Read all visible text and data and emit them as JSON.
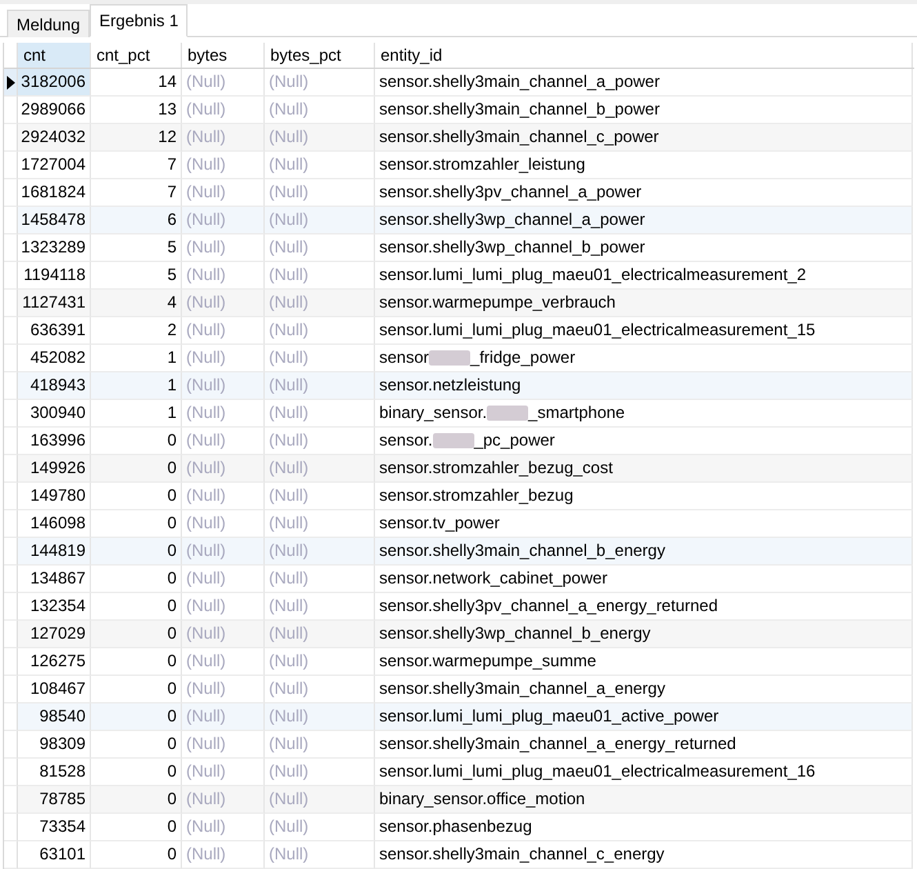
{
  "tabs": [
    {
      "label": "Meldung",
      "selected": false
    },
    {
      "label": "Ergebnis 1",
      "selected": true
    }
  ],
  "table": {
    "columns": [
      {
        "label": "cnt",
        "kind": "number",
        "selected": true
      },
      {
        "label": "cnt_pct",
        "kind": "number",
        "selected": false
      },
      {
        "label": "bytes",
        "kind": "text",
        "selected": false
      },
      {
        "label": "bytes_pct",
        "kind": "text",
        "selected": false
      },
      {
        "label": "entity_id",
        "kind": "text",
        "selected": false
      }
    ],
    "rows": [
      {
        "selected": true,
        "cells": [
          {
            "text": "3182006",
            "null": false
          },
          {
            "text": "14",
            "null": false
          },
          {
            "text": "(Null)",
            "null": true
          },
          {
            "text": "(Null)",
            "null": true
          },
          {
            "text": "sensor.shelly3main_channel_a_power",
            "null": false,
            "redacted": false
          }
        ]
      },
      {
        "selected": false,
        "cells": [
          {
            "text": "2989066",
            "null": false
          },
          {
            "text": "13",
            "null": false
          },
          {
            "text": "(Null)",
            "null": true
          },
          {
            "text": "(Null)",
            "null": true
          },
          {
            "text": "sensor.shelly3main_channel_b_power",
            "null": false,
            "redacted": false
          }
        ]
      },
      {
        "selected": false,
        "cells": [
          {
            "text": "2924032",
            "null": false
          },
          {
            "text": "12",
            "null": false
          },
          {
            "text": "(Null)",
            "null": true
          },
          {
            "text": "(Null)",
            "null": true
          },
          {
            "text": "sensor.shelly3main_channel_c_power",
            "null": false,
            "redacted": false
          }
        ]
      },
      {
        "selected": false,
        "cells": [
          {
            "text": "1727004",
            "null": false
          },
          {
            "text": "7",
            "null": false
          },
          {
            "text": "(Null)",
            "null": true
          },
          {
            "text": "(Null)",
            "null": true
          },
          {
            "text": "sensor.stromzahler_leistung",
            "null": false,
            "redacted": false
          }
        ]
      },
      {
        "selected": false,
        "cells": [
          {
            "text": "1681824",
            "null": false
          },
          {
            "text": "7",
            "null": false
          },
          {
            "text": "(Null)",
            "null": true
          },
          {
            "text": "(Null)",
            "null": true
          },
          {
            "text": "sensor.shelly3pv_channel_a_power",
            "null": false,
            "redacted": false
          }
        ]
      },
      {
        "selected": false,
        "cells": [
          {
            "text": "1458478",
            "null": false
          },
          {
            "text": "6",
            "null": false
          },
          {
            "text": "(Null)",
            "null": true
          },
          {
            "text": "(Null)",
            "null": true
          },
          {
            "text": "sensor.shelly3wp_channel_a_power",
            "null": false,
            "redacted": false
          }
        ]
      },
      {
        "selected": false,
        "cells": [
          {
            "text": "1323289",
            "null": false
          },
          {
            "text": "5",
            "null": false
          },
          {
            "text": "(Null)",
            "null": true
          },
          {
            "text": "(Null)",
            "null": true
          },
          {
            "text": "sensor.shelly3wp_channel_b_power",
            "null": false,
            "redacted": false
          }
        ]
      },
      {
        "selected": false,
        "cells": [
          {
            "text": "1194118",
            "null": false
          },
          {
            "text": "5",
            "null": false
          },
          {
            "text": "(Null)",
            "null": true
          },
          {
            "text": "(Null)",
            "null": true
          },
          {
            "text": "sensor.lumi_lumi_plug_maeu01_electricalmeasurement_2",
            "null": false,
            "redacted": false
          }
        ]
      },
      {
        "selected": false,
        "cells": [
          {
            "text": "1127431",
            "null": false
          },
          {
            "text": "4",
            "null": false
          },
          {
            "text": "(Null)",
            "null": true
          },
          {
            "text": "(Null)",
            "null": true
          },
          {
            "text": "sensor.warmepumpe_verbrauch",
            "null": false,
            "redacted": false
          }
        ]
      },
      {
        "selected": false,
        "cells": [
          {
            "text": "636391",
            "null": false
          },
          {
            "text": "2",
            "null": false
          },
          {
            "text": "(Null)",
            "null": true
          },
          {
            "text": "(Null)",
            "null": true
          },
          {
            "text": "sensor.lumi_lumi_plug_maeu01_electricalmeasurement_15",
            "null": false,
            "redacted": false
          }
        ]
      },
      {
        "selected": false,
        "cells": [
          {
            "text": "452082",
            "null": false
          },
          {
            "text": "1",
            "null": false
          },
          {
            "text": "(Null)",
            "null": true
          },
          {
            "text": "(Null)",
            "null": true
          },
          {
            "text": "sensor",
            "null": false,
            "redacted": true,
            "text_after": "_fridge_power"
          }
        ]
      },
      {
        "selected": false,
        "cells": [
          {
            "text": "418943",
            "null": false
          },
          {
            "text": "1",
            "null": false
          },
          {
            "text": "(Null)",
            "null": true
          },
          {
            "text": "(Null)",
            "null": true
          },
          {
            "text": "sensor.netzleistung",
            "null": false,
            "redacted": false
          }
        ]
      },
      {
        "selected": false,
        "cells": [
          {
            "text": "300940",
            "null": false
          },
          {
            "text": "1",
            "null": false
          },
          {
            "text": "(Null)",
            "null": true
          },
          {
            "text": "(Null)",
            "null": true
          },
          {
            "text": "binary_sensor.",
            "null": false,
            "redacted": true,
            "text_after": "_smartphone"
          }
        ]
      },
      {
        "selected": false,
        "cells": [
          {
            "text": "163996",
            "null": false
          },
          {
            "text": "0",
            "null": false
          },
          {
            "text": "(Null)",
            "null": true
          },
          {
            "text": "(Null)",
            "null": true
          },
          {
            "text": "sensor.",
            "null": false,
            "redacted": true,
            "text_after": "_pc_power"
          }
        ]
      },
      {
        "selected": false,
        "cells": [
          {
            "text": "149926",
            "null": false
          },
          {
            "text": "0",
            "null": false
          },
          {
            "text": "(Null)",
            "null": true
          },
          {
            "text": "(Null)",
            "null": true
          },
          {
            "text": "sensor.stromzahler_bezug_cost",
            "null": false,
            "redacted": false
          }
        ]
      },
      {
        "selected": false,
        "cells": [
          {
            "text": "149780",
            "null": false
          },
          {
            "text": "0",
            "null": false
          },
          {
            "text": "(Null)",
            "null": true
          },
          {
            "text": "(Null)",
            "null": true
          },
          {
            "text": "sensor.stromzahler_bezug",
            "null": false,
            "redacted": false
          }
        ]
      },
      {
        "selected": false,
        "cells": [
          {
            "text": "146098",
            "null": false
          },
          {
            "text": "0",
            "null": false
          },
          {
            "text": "(Null)",
            "null": true
          },
          {
            "text": "(Null)",
            "null": true
          },
          {
            "text": "sensor.tv_power",
            "null": false,
            "redacted": false
          }
        ]
      },
      {
        "selected": false,
        "cells": [
          {
            "text": "144819",
            "null": false
          },
          {
            "text": "0",
            "null": false
          },
          {
            "text": "(Null)",
            "null": true
          },
          {
            "text": "(Null)",
            "null": true
          },
          {
            "text": "sensor.shelly3main_channel_b_energy",
            "null": false,
            "redacted": false
          }
        ]
      },
      {
        "selected": false,
        "cells": [
          {
            "text": "134867",
            "null": false
          },
          {
            "text": "0",
            "null": false
          },
          {
            "text": "(Null)",
            "null": true
          },
          {
            "text": "(Null)",
            "null": true
          },
          {
            "text": "sensor.network_cabinet_power",
            "null": false,
            "redacted": false
          }
        ]
      },
      {
        "selected": false,
        "cells": [
          {
            "text": "132354",
            "null": false
          },
          {
            "text": "0",
            "null": false
          },
          {
            "text": "(Null)",
            "null": true
          },
          {
            "text": "(Null)",
            "null": true
          },
          {
            "text": "sensor.shelly3pv_channel_a_energy_returned",
            "null": false,
            "redacted": false
          }
        ]
      },
      {
        "selected": false,
        "cells": [
          {
            "text": "127029",
            "null": false
          },
          {
            "text": "0",
            "null": false
          },
          {
            "text": "(Null)",
            "null": true
          },
          {
            "text": "(Null)",
            "null": true
          },
          {
            "text": "sensor.shelly3wp_channel_b_energy",
            "null": false,
            "redacted": false
          }
        ]
      },
      {
        "selected": false,
        "cells": [
          {
            "text": "126275",
            "null": false
          },
          {
            "text": "0",
            "null": false
          },
          {
            "text": "(Null)",
            "null": true
          },
          {
            "text": "(Null)",
            "null": true
          },
          {
            "text": "sensor.warmepumpe_summe",
            "null": false,
            "redacted": false
          }
        ]
      },
      {
        "selected": false,
        "cells": [
          {
            "text": "108467",
            "null": false
          },
          {
            "text": "0",
            "null": false
          },
          {
            "text": "(Null)",
            "null": true
          },
          {
            "text": "(Null)",
            "null": true
          },
          {
            "text": "sensor.shelly3main_channel_a_energy",
            "null": false,
            "redacted": false
          }
        ]
      },
      {
        "selected": false,
        "cells": [
          {
            "text": "98540",
            "null": false
          },
          {
            "text": "0",
            "null": false
          },
          {
            "text": "(Null)",
            "null": true
          },
          {
            "text": "(Null)",
            "null": true
          },
          {
            "text": "sensor.lumi_lumi_plug_maeu01_active_power",
            "null": false,
            "redacted": false
          }
        ]
      },
      {
        "selected": false,
        "cells": [
          {
            "text": "98309",
            "null": false
          },
          {
            "text": "0",
            "null": false
          },
          {
            "text": "(Null)",
            "null": true
          },
          {
            "text": "(Null)",
            "null": true
          },
          {
            "text": "sensor.shelly3main_channel_a_energy_returned",
            "null": false,
            "redacted": false
          }
        ]
      },
      {
        "selected": false,
        "cells": [
          {
            "text": "81528",
            "null": false
          },
          {
            "text": "0",
            "null": false
          },
          {
            "text": "(Null)",
            "null": true
          },
          {
            "text": "(Null)",
            "null": true
          },
          {
            "text": "sensor.lumi_lumi_plug_maeu01_electricalmeasurement_16",
            "null": false,
            "redacted": false
          }
        ]
      },
      {
        "selected": false,
        "cells": [
          {
            "text": "78785",
            "null": false
          },
          {
            "text": "0",
            "null": false
          },
          {
            "text": "(Null)",
            "null": true
          },
          {
            "text": "(Null)",
            "null": true
          },
          {
            "text": "binary_sensor.office_motion",
            "null": false,
            "redacted": false
          }
        ]
      },
      {
        "selected": false,
        "cells": [
          {
            "text": "73354",
            "null": false
          },
          {
            "text": "0",
            "null": false
          },
          {
            "text": "(Null)",
            "null": true
          },
          {
            "text": "(Null)",
            "null": true
          },
          {
            "text": "sensor.phasenbezug",
            "null": false,
            "redacted": false
          }
        ]
      },
      {
        "selected": false,
        "cells": [
          {
            "text": "63101",
            "null": false
          },
          {
            "text": "0",
            "null": false
          },
          {
            "text": "(Null)",
            "null": true
          },
          {
            "text": "(Null)",
            "null": true
          },
          {
            "text": "sensor.shelly3main_channel_c_energy",
            "null": false,
            "redacted": false
          }
        ]
      }
    ]
  }
}
